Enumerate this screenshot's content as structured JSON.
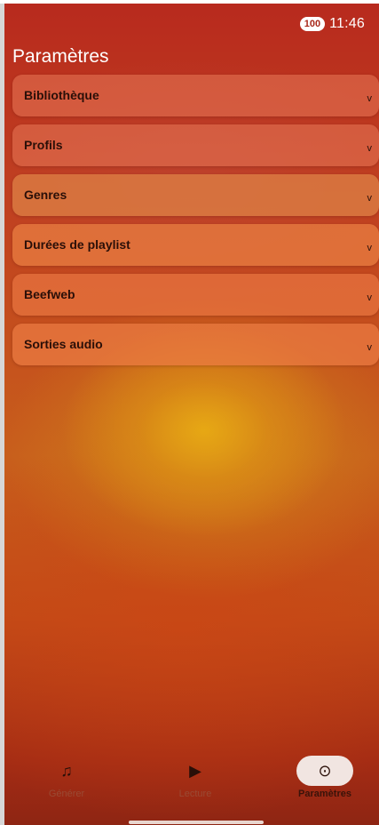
{
  "status_bar": {
    "battery": "100",
    "time": "11:46"
  },
  "page": {
    "title": "Paramètres"
  },
  "settings": {
    "items": [
      {
        "label": "Bibliothèque",
        "chevron": "v"
      },
      {
        "label": "Profils",
        "chevron": "v"
      },
      {
        "label": "Genres",
        "chevron": "v"
      },
      {
        "label": "Durées de playlist",
        "chevron": "v"
      },
      {
        "label": "Beefweb",
        "chevron": "v"
      },
      {
        "label": "Sorties audio",
        "chevron": "v"
      }
    ]
  },
  "bottom_nav": {
    "items": [
      {
        "label": "Générer",
        "icon": "music-note-icon",
        "glyph": "♫",
        "active": false
      },
      {
        "label": "Lecture",
        "icon": "play-icon",
        "glyph": "▶",
        "active": false
      },
      {
        "label": "Paramètres",
        "icon": "settings-icon",
        "glyph": "⊙",
        "active": true
      }
    ]
  },
  "colors": {
    "background_top": "#b82a1e",
    "background_glow": "#e8aa14",
    "card_tint": "#e87858",
    "active_nav_pill": "#f1e5e1"
  }
}
